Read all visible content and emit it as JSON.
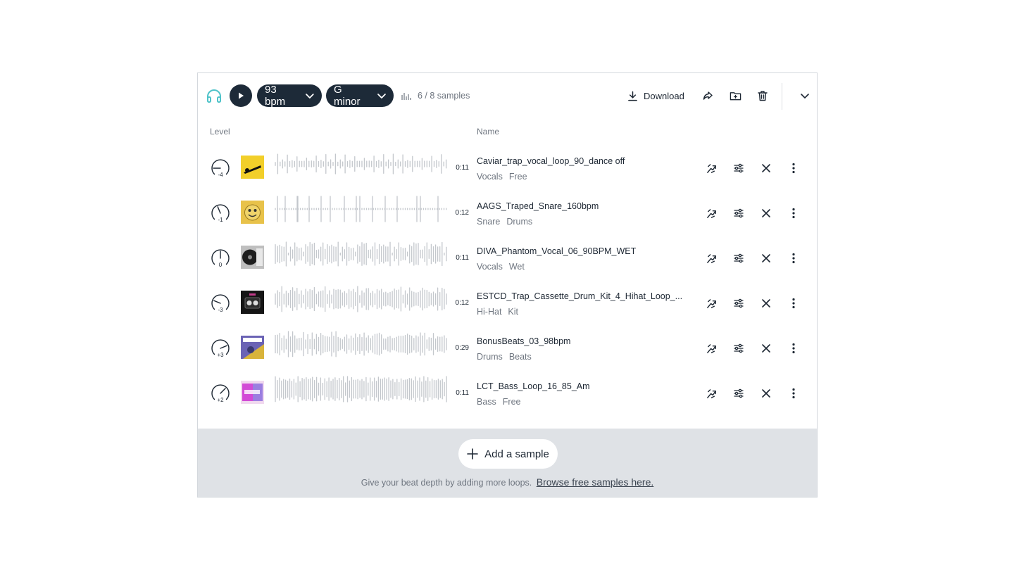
{
  "toolbar": {
    "headphones_icon": "headphones-icon",
    "play_icon": "play-icon",
    "bpm": "93 bpm",
    "key": "G minor",
    "sample_count": "6 / 8 samples",
    "download_label": "Download",
    "accent_color": "#4fc3c9",
    "pill_color": "#1d2a38"
  },
  "columns": {
    "level": "Level",
    "name": "Name"
  },
  "samples": [
    {
      "level": "-4",
      "title": "Caviar_trap_vocal_loop_90_dance off",
      "tags": [
        "Vocals",
        "Free"
      ],
      "duration": "0:11"
    },
    {
      "level": "-1",
      "title": "AAGS_Traped_Snare_160bpm",
      "tags": [
        "Snare",
        "Drums"
      ],
      "duration": "0:12"
    },
    {
      "level": "0",
      "title": "DIVA_Phantom_Vocal_06_90BPM_WET",
      "tags": [
        "Vocals",
        "Wet"
      ],
      "duration": "0:11"
    },
    {
      "level": "-3",
      "title": "ESTCD_Trap_Cassette_Drum_Kit_4_Hihat_Loop_...",
      "tags": [
        "Hi-Hat",
        "Kit"
      ],
      "duration": "0:12"
    },
    {
      "level": "+3",
      "title": "BonusBeats_03_98bpm",
      "tags": [
        "Drums",
        "Beats"
      ],
      "duration": "0:29"
    },
    {
      "level": "+2",
      "title": "LCT_Bass_Loop_16_85_Am",
      "tags": [
        "Bass",
        "Free"
      ],
      "duration": "0:11"
    }
  ],
  "footer": {
    "add_label": "Add a sample",
    "text": "Give your beat depth by adding more loops.",
    "link": "Browse free samples here."
  }
}
